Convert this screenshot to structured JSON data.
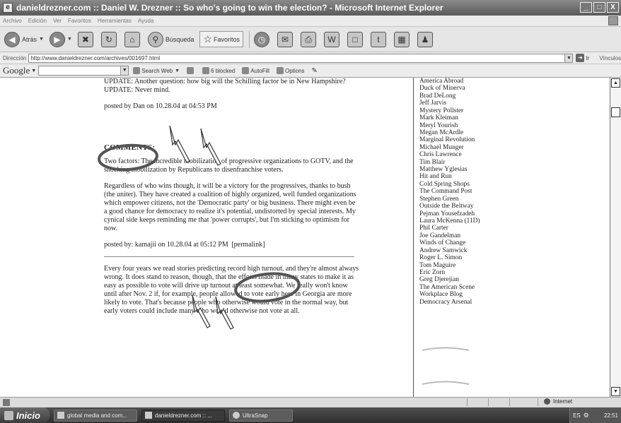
{
  "window": {
    "title": "danieldrezner.com :: Daniel W. Drezner :: So who's going to win the election? - Microsoft Internet Explorer",
    "app_icon": "ie-page-icon",
    "controls": [
      "_",
      "□",
      "X"
    ]
  },
  "menu": [
    "Archivo",
    "Edición",
    "Ver",
    "Favoritos",
    "Herramientas",
    "Ayuda"
  ],
  "toolbar": {
    "back_label": "Atrás",
    "search_label": "Búsqueda",
    "favorites_label": "Favoritos"
  },
  "address": {
    "label": "Dirección",
    "url": "http://www.danieldrezner.com/archives/001697.html",
    "go_label": "Ir",
    "links_label": "Vínculos"
  },
  "googlebar": {
    "logo": "Google",
    "search_web": "Search Web",
    "blocked": "6 blocked",
    "autofill": "AutoFill",
    "options": "Options"
  },
  "article": {
    "update_text": "UPDATE: Another question: how big will the Schilling factor be in New Hampshire? UPDATE: Never mind.",
    "posted_by": "posted by Dan on 10.28.04 at 04:53 PM",
    "comments_heading": "COMMENTS:",
    "comments": [
      {
        "paragraphs": [
          "Two factors: The incredible mobilization of progressive organizations to GOTV, and the shocking mobilization by Republicans to disenfranchise voters.",
          "Regardless of who wins though, it will be a victory for the progressives, thanks to bush (the uniter). They have created a coalition of highly organized, well funded organizations which empower citizens, not the 'Democratic party' or big business. There might even be a good chance for democracy to realize it's potential, undistorted by special interests. My cynical side keeps reminding me that 'power corrupts', but I'm sticking to optimism for now."
        ],
        "posted_by": "posted by: kamajii on 10.28.04 at 05:12 PM",
        "permalink": "[permalink]"
      }
    ],
    "second_comment": "Every four years we read stories predicting record high turnout, and they're almost always wrong. It does stand to reason, though, that the efforts made in many states to make it as easy as possible to vote will drive up turnout at least somewhat. We really won't know until after Nov. 2 if, for example, people allowed to vote early here in Georgia are more likely to vote. That's because people who otherwise would vote in the normal way, but early voters could include many who would otherwise not vote at all."
  },
  "blogroll": [
    "America Abroad",
    "Duck of Minerva",
    "Brad DeLong",
    "Jeff Jarvis",
    "Mystery Pollster",
    "Mark Kleiman",
    "Meryl Yourish",
    "Megan McArdle",
    "Marginal Revolution",
    "Michael Munger",
    "Chris Lawrence",
    "Tim Blair",
    "Matthew Yglesias",
    "Hit and Run",
    "Cold Spring Shops",
    "The Command Post",
    "Stephen Green",
    "Outside the Beltway",
    "Pejman Yousefzadeh",
    "Laura McKenna (11D)",
    "Phil Carter",
    "Joe Gandelman",
    "Winds of Change",
    "Andrew Samwick",
    "Roger L. Simon",
    "Tom Maguire",
    "Eric Zorn",
    "Greg Djerejian",
    "The American Scene",
    "Workplace Blog",
    "Democracy Arsenal"
  ],
  "status": {
    "zone": "Internet"
  },
  "taskbar": {
    "start": "Inicio",
    "tasks": [
      {
        "label": "global media and com...",
        "active": false
      },
      {
        "label": "danieldrezner.com :: ...",
        "active": true
      },
      {
        "label": "UltraSnap",
        "active": false
      }
    ],
    "tray_lang": "ES",
    "clock": "22:51"
  },
  "colors": {
    "annotation": "#555555"
  }
}
